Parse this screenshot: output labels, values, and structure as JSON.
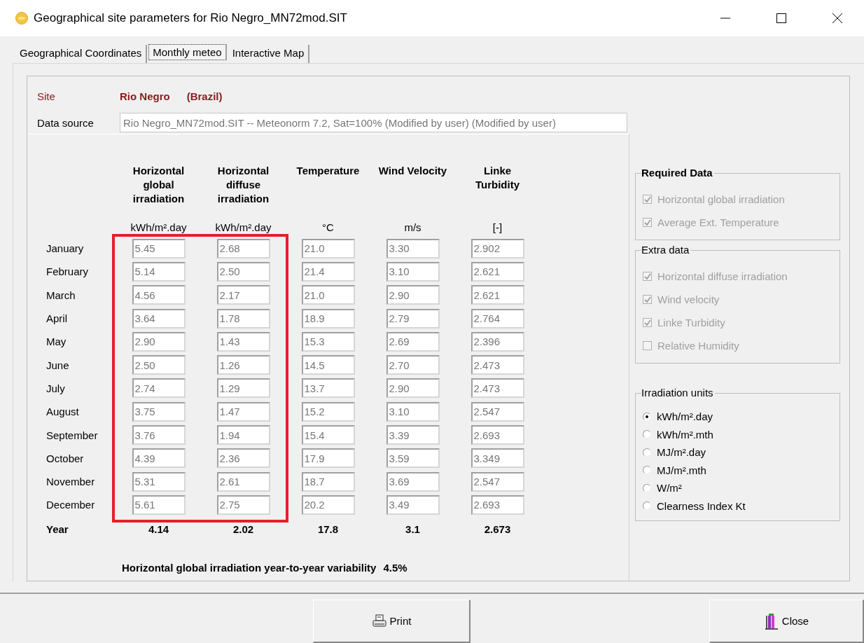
{
  "window": {
    "title": "Geographical site parameters for Rio Negro_MN72mod.SIT"
  },
  "tabs": [
    {
      "label": "Geographical Coordinates",
      "selected": false
    },
    {
      "label": "Monthly meteo",
      "selected": true
    },
    {
      "label": "Interactive Map",
      "selected": false
    }
  ],
  "site": {
    "label": "Site",
    "name": "Rio Negro",
    "country": "(Brazil)"
  },
  "data_source": {
    "label": "Data source",
    "value": "Rio Negro_MN72mod.SIT -- Meteonorm 7.2, Sat=100% (Modified by user) (Modified by user)"
  },
  "table": {
    "columns": [
      {
        "heading": "Horizontal global irradiation",
        "unit": "kWh/m².day",
        "highlighted": true,
        "year": "4.14"
      },
      {
        "heading": "Horizontal diffuse irradiation",
        "unit": "kWh/m².day",
        "highlighted": true,
        "year": "2.02"
      },
      {
        "heading": "Temperature",
        "unit": "°C",
        "highlighted": false,
        "year": "17.8"
      },
      {
        "heading": "Wind Velocity",
        "unit": "m/s",
        "highlighted": false,
        "year": "3.1"
      },
      {
        "heading": "Linke Turbidity",
        "unit": "[-]",
        "highlighted": false,
        "year": "2.673"
      }
    ],
    "rows": [
      {
        "month": "January",
        "values": [
          "5.45",
          "2.68",
          "21.0",
          "3.30",
          "2.902"
        ]
      },
      {
        "month": "February",
        "values": [
          "5.14",
          "2.50",
          "21.4",
          "3.10",
          "2.621"
        ]
      },
      {
        "month": "March",
        "values": [
          "4.56",
          "2.17",
          "21.0",
          "2.90",
          "2.621"
        ]
      },
      {
        "month": "April",
        "values": [
          "3.64",
          "1.78",
          "18.9",
          "2.79",
          "2.764"
        ]
      },
      {
        "month": "May",
        "values": [
          "2.90",
          "1.43",
          "15.3",
          "2.69",
          "2.396"
        ]
      },
      {
        "month": "June",
        "values": [
          "2.50",
          "1.26",
          "14.5",
          "2.70",
          "2.473"
        ]
      },
      {
        "month": "July",
        "values": [
          "2.74",
          "1.29",
          "13.7",
          "2.90",
          "2.473"
        ]
      },
      {
        "month": "August",
        "values": [
          "3.75",
          "1.47",
          "15.2",
          "3.10",
          "2.547"
        ]
      },
      {
        "month": "September",
        "values": [
          "3.76",
          "1.94",
          "15.4",
          "3.39",
          "2.693"
        ]
      },
      {
        "month": "October",
        "values": [
          "4.39",
          "2.36",
          "17.9",
          "3.59",
          "3.349"
        ]
      },
      {
        "month": "November",
        "values": [
          "5.31",
          "2.61",
          "18.7",
          "3.69",
          "2.547"
        ]
      },
      {
        "month": "December",
        "values": [
          "5.61",
          "2.75",
          "20.2",
          "3.49",
          "2.693"
        ]
      }
    ],
    "year_label": "Year"
  },
  "variability": {
    "label": "Horizontal global irradiation year-to-year variability",
    "value": "4.5%"
  },
  "required_data": {
    "title": "Required Data",
    "items": [
      {
        "label": "Horizontal global irradiation",
        "checked": true,
        "disabled": true
      },
      {
        "label": "Average Ext. Temperature",
        "checked": true,
        "disabled": true
      }
    ]
  },
  "extra_data": {
    "title": "Extra data",
    "items": [
      {
        "label": "Horizontal diffuse irradiation",
        "checked": true,
        "disabled": true
      },
      {
        "label": "Wind velocity",
        "checked": true,
        "disabled": true
      },
      {
        "label": "Linke Turbidity",
        "checked": true,
        "disabled": true
      },
      {
        "label": "Relative Humidity",
        "checked": false,
        "disabled": true
      }
    ]
  },
  "irradiation_units": {
    "title": "Irradiation units",
    "options": [
      {
        "label": "kWh/m².day",
        "selected": true
      },
      {
        "label": "kWh/m².mth",
        "selected": false
      },
      {
        "label": "MJ/m².day",
        "selected": false
      },
      {
        "label": "MJ/m².mth",
        "selected": false
      },
      {
        "label": "W/m²",
        "selected": false
      },
      {
        "label": "Clearness Index Kt",
        "selected": false
      }
    ]
  },
  "buttons": [
    {
      "kind": "print",
      "label": "Print"
    },
    {
      "kind": "close",
      "label": "Close"
    }
  ]
}
